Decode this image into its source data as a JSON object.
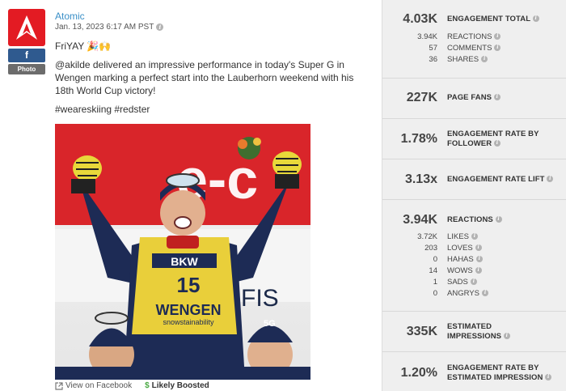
{
  "post": {
    "author": "Atomic",
    "date": "Jan. 13, 2023 6:17 AM PST",
    "network_badge": "f",
    "type_badge": "Photo",
    "line1": "FriYAY 🎉🙌",
    "body": "@akilde delivered an impressive performance in today's Super G in Wengen marking a perfect start into the Lauberhorn weekend with his 18th World Cup victory!",
    "hashtags": "#weareskiing #redster",
    "photo_texts": {
      "bib_number": "15",
      "bib_sponsor": "BKW",
      "bib_event": "WENGEN",
      "bib_tagline": "snowstainability",
      "backdrop": "FIS",
      "cap_sponsor": "5G"
    },
    "view_link": "View on Facebook",
    "boost_label": "Likely Boosted",
    "boost_icon": "$"
  },
  "metrics": {
    "engagement_total": {
      "value": "4.03K",
      "label": "ENGAGEMENT TOTAL"
    },
    "engagement_breakdown": [
      {
        "value": "3.94K",
        "label": "REACTIONS"
      },
      {
        "value": "57",
        "label": "COMMENTS"
      },
      {
        "value": "36",
        "label": "SHARES"
      }
    ],
    "page_fans": {
      "value": "227K",
      "label": "PAGE FANS"
    },
    "er_follower": {
      "value": "1.78%",
      "label1": "ENGAGEMENT RATE BY",
      "label2": "FOLLOWER"
    },
    "er_lift": {
      "value": "3.13x",
      "label": "ENGAGEMENT RATE LIFT"
    },
    "reactions": {
      "value": "3.94K",
      "label": "REACTIONS"
    },
    "reactions_breakdown": [
      {
        "value": "3.72K",
        "label": "LIKES"
      },
      {
        "value": "203",
        "label": "LOVES"
      },
      {
        "value": "0",
        "label": "HAHAS"
      },
      {
        "value": "14",
        "label": "WOWS"
      },
      {
        "value": "1",
        "label": "SADS"
      },
      {
        "value": "0",
        "label": "ANGRYS"
      }
    ],
    "est_impressions": {
      "value": "335K",
      "label1": "ESTIMATED",
      "label2": "IMPRESSIONS"
    },
    "er_impression": {
      "value": "1.20%",
      "label1": "ENGAGEMENT RATE BY",
      "label2": "ESTIMATED IMPRESSION"
    }
  },
  "colors": {
    "brand_red": "#e31b23",
    "facebook_blue": "#2f5a8f",
    "link_blue": "#3a8fc7",
    "panel_bg": "#efefef",
    "boost_green": "#4caa45"
  }
}
